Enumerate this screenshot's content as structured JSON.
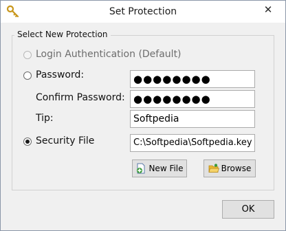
{
  "window": {
    "title": "Set Protection",
    "close_glyph": "✕",
    "icon": "key-icon"
  },
  "group": {
    "label": "Select New Protection",
    "options": {
      "login": {
        "label": "Login Authentication (Default)",
        "selected": false,
        "enabled": false
      },
      "password": {
        "label": "Password:",
        "selected": false,
        "enabled": true
      },
      "security_file": {
        "label": "Security File",
        "selected": true,
        "enabled": true
      }
    },
    "password_value": "●●●●●●●●",
    "confirm_label": "Confirm Password:",
    "confirm_value": "●●●●●●●●",
    "tip_label": "Tip:",
    "tip_value": "Softpedia",
    "file_path": "C:\\Softpedia\\Softpedia.key"
  },
  "buttons": {
    "new_file": {
      "label": "New File",
      "icon": "new-file-icon"
    },
    "browse": {
      "label": "Browse",
      "icon": "folder-open-icon"
    },
    "ok": {
      "label": "OK"
    }
  },
  "colors": {
    "accent_green": "#3a9a3a",
    "folder_yellow": "#e8b830",
    "key_gold": "#d9a520"
  }
}
